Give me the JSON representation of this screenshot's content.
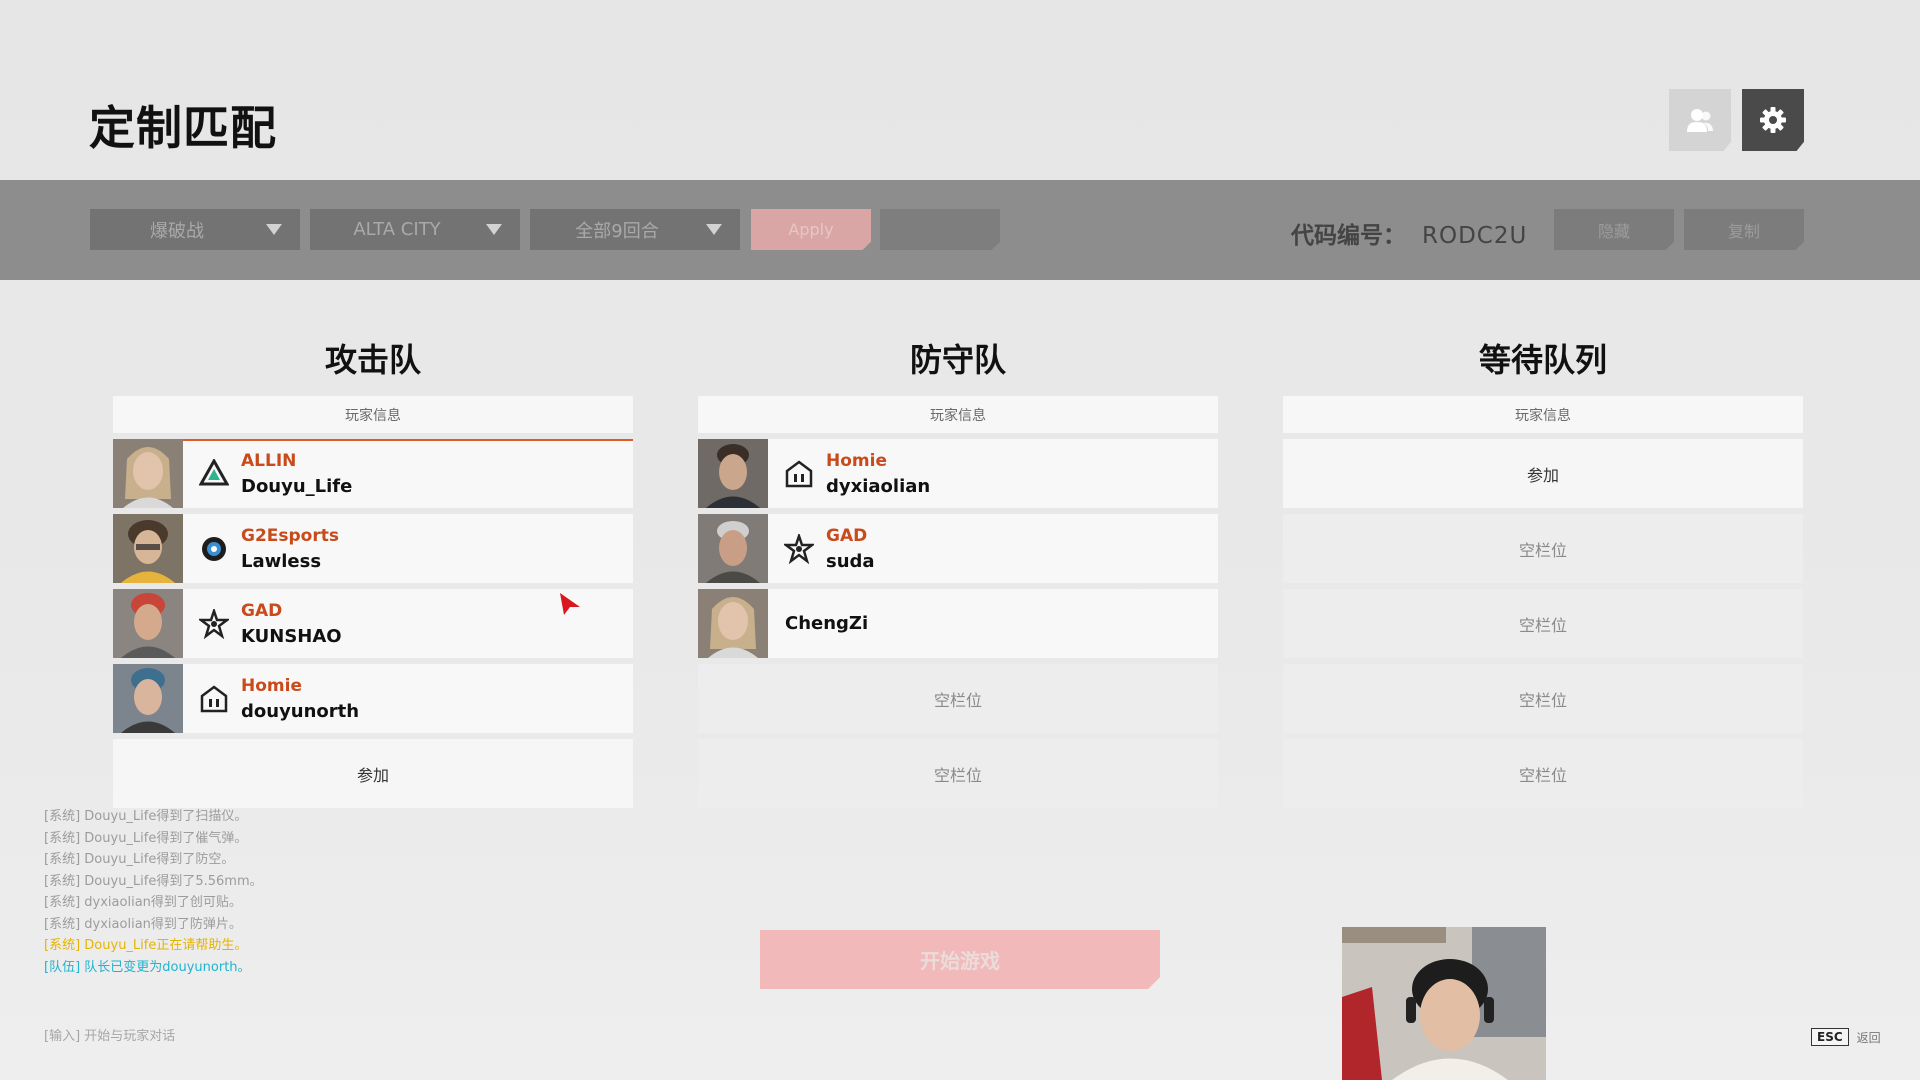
{
  "page": {
    "title": "定制匹配"
  },
  "header_buttons": {
    "friends_icon": "person-icon",
    "settings_icon": "gear-icon"
  },
  "toolbar": {
    "mode": "爆破战",
    "map": "ALTA CITY",
    "rounds": "全部9回合",
    "apply_label": "Apply",
    "reset_label": "",
    "room_code_label": "代码编号：",
    "room_code": "RODC2U",
    "hide_label": "隐藏",
    "copy_label": "复制"
  },
  "columns": {
    "attack": {
      "title": "攻击队",
      "header": "玩家信息",
      "slots": [
        {
          "team": "ALLIN",
          "player": "Douyu_Life",
          "team_logo": "triangle-logo-icon"
        },
        {
          "team": "G2Esports",
          "player": "Lawless",
          "team_logo": "lion-logo-icon"
        },
        {
          "team": "GAD",
          "player": "KUNSHAO",
          "team_logo": "star-logo-icon"
        },
        {
          "team": "Homie",
          "player": "douyunorth",
          "team_logo": "house-logo-icon"
        }
      ],
      "join_label": "参加"
    },
    "defense": {
      "title": "防守队",
      "header": "玩家信息",
      "slots": [
        {
          "team": "Homie",
          "player": "dyxiaolian",
          "team_logo": "house-logo-icon"
        },
        {
          "team": "GAD",
          "player": "suda",
          "team_logo": "star-logo-icon"
        },
        {
          "team": "",
          "player": "ChengZi"
        }
      ],
      "empty_labels": [
        "空栏位",
        "空栏位"
      ]
    },
    "queue": {
      "title": "等待队列",
      "header": "玩家信息",
      "join_label": "参加",
      "empty_labels": [
        "空栏位",
        "空栏位",
        "空栏位",
        "空栏位"
      ]
    }
  },
  "chat": {
    "lines": [
      {
        "tag": "[系统]",
        "text": "Douyu_Life得到了扫描仪。",
        "kind": "system"
      },
      {
        "tag": "[系统]",
        "text": "Douyu_Life得到了催气弹。",
        "kind": "system"
      },
      {
        "tag": "[系统]",
        "text": "Douyu_Life得到了防空。",
        "kind": "system"
      },
      {
        "tag": "[系统]",
        "text": "Douyu_Life得到了5.56mm。",
        "kind": "system"
      },
      {
        "tag": "[系统]",
        "text": "dyxiaolian得到了创可贴。",
        "kind": "system"
      },
      {
        "tag": "[系统]",
        "text": "dyxiaolian得到了防弹片。",
        "kind": "system"
      },
      {
        "tag": "[系统]",
        "text": "Douyu_Life正在请帮助生。",
        "kind": "warn"
      },
      {
        "tag": "[队伍]",
        "text": "队长已变更为douyunorth。",
        "kind": "team"
      }
    ],
    "input_hint": "[输入] 开始与玩家对话"
  },
  "start_button": {
    "label": "开始游戏"
  },
  "footer": {
    "esc_key": "ESC",
    "esc_label": "返回"
  },
  "colors": {
    "accent": "#c94a1b",
    "start_disabled": "#f1b9b9",
    "toolbar": "#8d8d8d"
  }
}
